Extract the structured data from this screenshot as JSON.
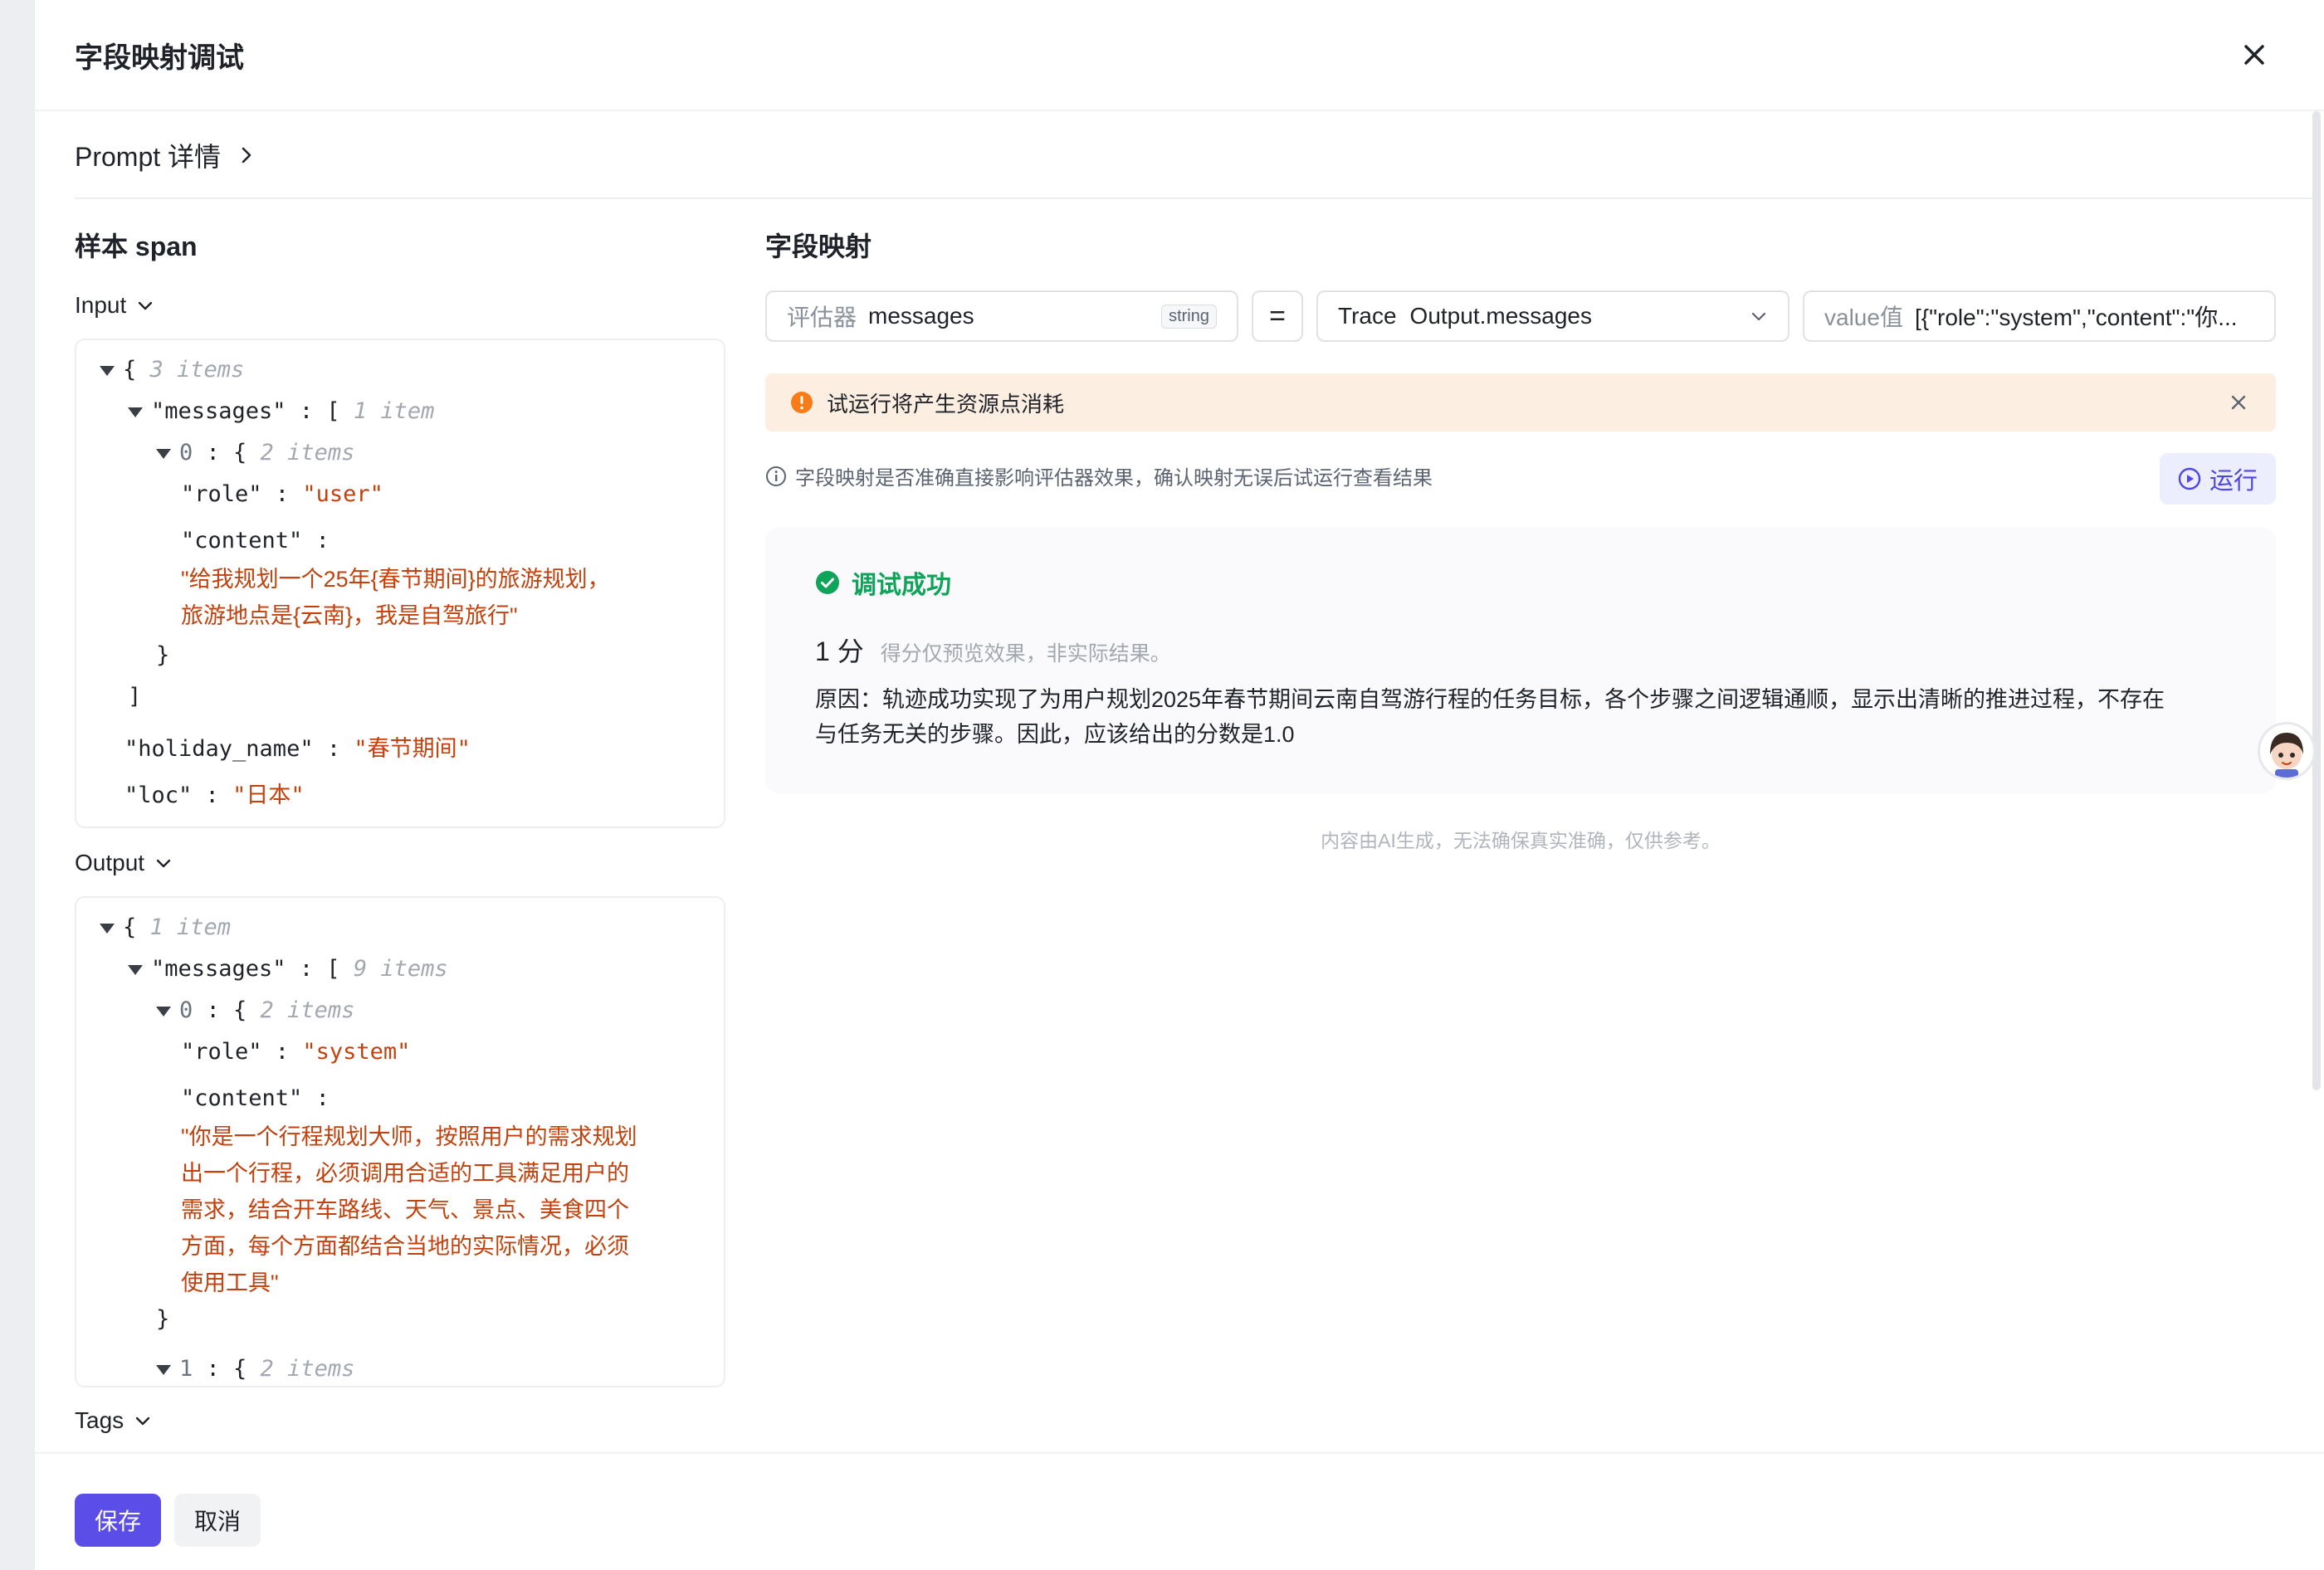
{
  "modal": {
    "title": "字段映射调试"
  },
  "prompt": {
    "label": "Prompt 详情"
  },
  "left": {
    "title": "样本 span",
    "input_label": "Input",
    "output_label": "Output",
    "tags_label": "Tags",
    "input_json": {
      "root_meta": "3 items",
      "messages_key": "\"messages\"",
      "messages_meta": "1 item",
      "item0_idx": "0",
      "item0_meta": "2 items",
      "role_key": "\"role\"",
      "role_val": "\"user\"",
      "content_key": "\"content\"",
      "content_line1": "\"给我规划一个25年{春节期间}的旅游规划，",
      "content_line2": "旅游地点是{云南}，我是自驾旅行\"",
      "holiday_key": "\"holiday_name\"",
      "holiday_val": "\"春节期间\"",
      "loc_key": "\"loc\"",
      "loc_val": "\"日本\""
    },
    "output_json": {
      "root_meta": "1 item",
      "messages_key": "\"messages\"",
      "messages_meta": "9 items",
      "item0_idx": "0",
      "item0_meta": "2 items",
      "role_key": "\"role\"",
      "role_val": "\"system\"",
      "content_key": "\"content\"",
      "content_lines": [
        "\"你是一个行程规划大师，按照用户的需求规划",
        "出一个行程，必须调用合适的工具满足用户的",
        "需求，结合开车路线、天气、景点、美食四个",
        "方面，每个方面都结合当地的实际情况，必须",
        "使用工具\""
      ],
      "item1_idx": "1",
      "item1_meta": "2 items"
    }
  },
  "right": {
    "title": "字段映射",
    "evaluator_label": "评估器",
    "evaluator_field": "messages",
    "evaluator_type": "string",
    "equals": "=",
    "trace_label": "Trace",
    "trace_field": "Output.messages",
    "value_label": "value值",
    "value_text": "[{\"role\":\"system\",\"content\":\"你...",
    "warning": "试运行将产生资源点消耗",
    "hint": "字段映射是否准确直接影响评估器效果，确认映射无误后试运行查看结果",
    "run_label": "运行",
    "result": {
      "status": "调试成功",
      "score": "1 分",
      "score_note": "得分仅预览效果，非实际结果。",
      "reason_line1": "原因：轨迹成功实现了为用户规划2025年春节期间云南自驾游行程的任务目标，各个步骤之间逻辑通顺，显示出清晰的推进过程，不存在",
      "reason_line2": "与任务无关的步骤。因此，应该给出的分数是1.0"
    },
    "disclaimer": "内容由AI生成，无法确保真实准确，仅供参考。"
  },
  "footer": {
    "save_label": "保存",
    "cancel_label": "取消"
  },
  "colors": {
    "primary": "#5b4ee8",
    "success": "#10a35a",
    "warning": "#f77b16",
    "string_value": "#c2410c"
  }
}
